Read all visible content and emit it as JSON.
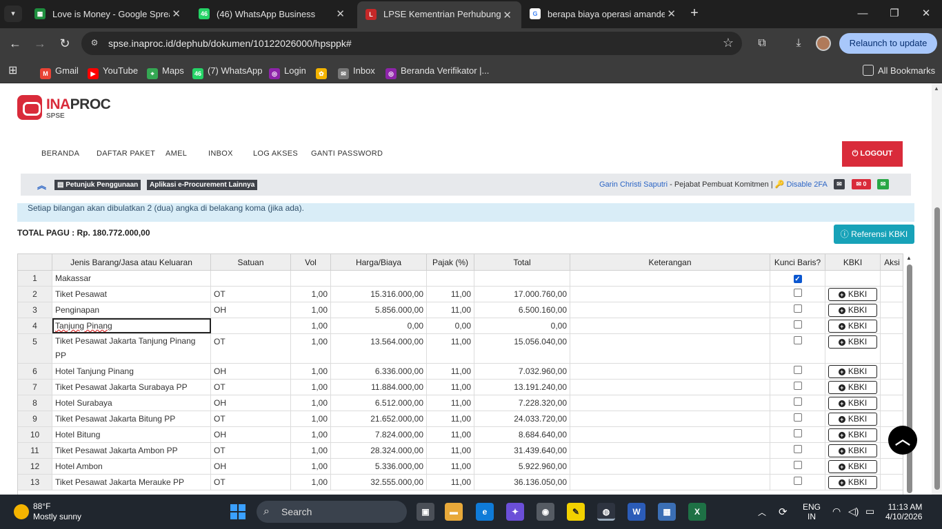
{
  "browser": {
    "tabs": [
      {
        "title": "Love is Money - Google Spread",
        "fav_color": "#1e8e3e",
        "fav_glyph": "▦"
      },
      {
        "title": "(46) WhatsApp Business",
        "fav_color": "#25d366",
        "fav_glyph": "46"
      },
      {
        "title": "LPSE Kementrian Perhubungan",
        "fav_color": "#c62828",
        "fav_glyph": "L"
      },
      {
        "title": "berapa biaya operasi amandel -",
        "fav_color": "#ffffff",
        "fav_glyph": "G"
      }
    ],
    "url": "spse.inaproc.id/dephub/dokumen/10122026000/hpsppk#",
    "relaunch_label": "Relaunch to update",
    "bookmarks": [
      {
        "label": "Gmail",
        "color": "#ea4335",
        "glyph": "M"
      },
      {
        "label": "YouTube",
        "color": "#ff0000",
        "glyph": "▶"
      },
      {
        "label": "Maps",
        "color": "#34a853",
        "glyph": "⌖"
      },
      {
        "label": "(7) WhatsApp",
        "color": "#25d366",
        "glyph": "46"
      },
      {
        "label": "Login",
        "color": "#8e24aa",
        "glyph": "◎"
      },
      {
        "label": "",
        "color": "#f4b400",
        "glyph": "✿"
      },
      {
        "label": "Inbox",
        "color": "#777777",
        "glyph": "✉"
      },
      {
        "label": "Beranda Verifikator |...",
        "color": "#8e24aa",
        "glyph": "◎"
      }
    ],
    "all_bookmarks": "All Bookmarks"
  },
  "site": {
    "logo_text_red": "INA",
    "logo_text_dark": "PROC",
    "logo_sub": "SPSE",
    "nav": [
      "BERANDA",
      "DAFTAR PAKET",
      "AMEL",
      "INBOX",
      "LOG AKSES",
      "GANTI PASSWORD"
    ],
    "logout_label": "⏻ LOGOUT",
    "guide_label": "Petunjuk Penggunaan",
    "apps_label": "Aplikasi e-Procurement Lainnya",
    "user_name": "Garin Christi Saputri",
    "user_role": " - Pejabat Pembuat Komitmen | ",
    "disable_2fa": "Disable 2FA",
    "mail_count": "0"
  },
  "content": {
    "notice": "Setiap bilangan akan dibulatkan 2 (dua) angka di belakang koma (jika ada).",
    "total_pagu": "TOTAL PAGU : Rp. 180.772.000,00",
    "kbki_ref_label": "Referensi KBKI",
    "headers": [
      "",
      "Jenis Barang/Jasa atau Keluaran",
      "Satuan",
      "Vol",
      "Harga/Biaya",
      "Pajak (%)",
      "Total",
      "Keterangan",
      "Kunci Baris?",
      "KBKI",
      "Aksi"
    ],
    "kbki_btn_label": "KBKI",
    "rows": [
      {
        "no": "1",
        "item": "Makassar",
        "satuan": "",
        "vol": "",
        "harga": "",
        "pajak": "",
        "total": "",
        "checked": true,
        "kbki": false
      },
      {
        "no": "2",
        "item": "Tiket Pesawat",
        "satuan": "OT",
        "vol": "1,00",
        "harga": "15.316.000,00",
        "pajak": "11,00",
        "total": "17.000.760,00",
        "checked": false,
        "kbki": true
      },
      {
        "no": "3",
        "item": "Penginapan",
        "satuan": "OH",
        "vol": "1,00",
        "harga": "5.856.000,00",
        "pajak": "11,00",
        "total": "6.500.160,00",
        "checked": false,
        "kbki": true
      },
      {
        "no": "4",
        "item": "Tanjung Pinang",
        "satuan": "",
        "vol": "1,00",
        "harga": "0,00",
        "pajak": "0,00",
        "total": "0,00",
        "checked": false,
        "kbki": true,
        "editing": true
      },
      {
        "no": "5",
        "item": "Tiket Pesawat Jakarta Tanjung Pinang PP",
        "satuan": "OT",
        "vol": "1,00",
        "harga": "13.564.000,00",
        "pajak": "11,00",
        "total": "15.056.040,00",
        "checked": false,
        "kbki": true,
        "tall": true
      },
      {
        "no": "6",
        "item": "Hotel Tanjung Pinang",
        "satuan": "OH",
        "vol": "1,00",
        "harga": "6.336.000,00",
        "pajak": "11,00",
        "total": "7.032.960,00",
        "checked": false,
        "kbki": true
      },
      {
        "no": "7",
        "item": "Tiket Pesawat Jakarta Surabaya PP",
        "satuan": "OT",
        "vol": "1,00",
        "harga": "11.884.000,00",
        "pajak": "11,00",
        "total": "13.191.240,00",
        "checked": false,
        "kbki": true
      },
      {
        "no": "8",
        "item": "Hotel Surabaya",
        "satuan": "OH",
        "vol": "1,00",
        "harga": "6.512.000,00",
        "pajak": "11,00",
        "total": "7.228.320,00",
        "checked": false,
        "kbki": true
      },
      {
        "no": "9",
        "item": "Tiket Pesawat Jakarta Bitung PP",
        "satuan": "OT",
        "vol": "1,00",
        "harga": "21.652.000,00",
        "pajak": "11,00",
        "total": "24.033.720,00",
        "checked": false,
        "kbki": true
      },
      {
        "no": "10",
        "item": "Hotel Bitung",
        "satuan": "OH",
        "vol": "1,00",
        "harga": "7.824.000,00",
        "pajak": "11,00",
        "total": "8.684.640,00",
        "checked": false,
        "kbki": true
      },
      {
        "no": "11",
        "item": "Tiket Pesawat Jakarta Ambon PP",
        "satuan": "OT",
        "vol": "1,00",
        "harga": "28.324.000,00",
        "pajak": "11,00",
        "total": "31.439.640,00",
        "checked": false,
        "kbki": true
      },
      {
        "no": "12",
        "item": "Hotel Ambon",
        "satuan": "OH",
        "vol": "1,00",
        "harga": "5.336.000,00",
        "pajak": "11,00",
        "total": "5.922.960,00",
        "checked": false,
        "kbki": true
      },
      {
        "no": "13",
        "item": "Tiket Pesawat Jakarta Merauke PP",
        "satuan": "OT",
        "vol": "1,00",
        "harga": "32.555.000,00",
        "pajak": "11,00",
        "total": "36.136.050,00",
        "checked": false,
        "kbki": true
      }
    ]
  },
  "taskbar": {
    "temp": "88°F",
    "weather": "Mostly sunny",
    "search_label": "Search",
    "lang": "ENG",
    "region": "IN",
    "time": "11:13 AM",
    "date": "4/10/2026"
  }
}
